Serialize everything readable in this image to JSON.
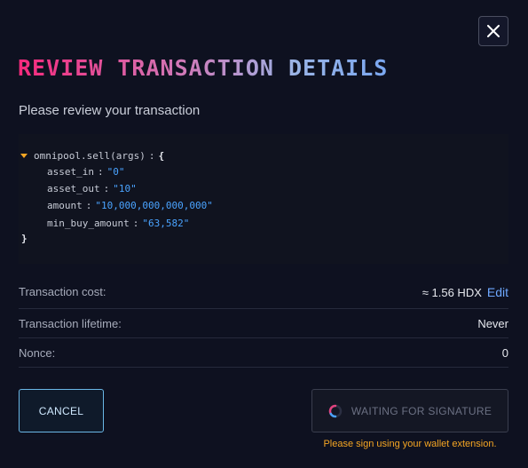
{
  "modal": {
    "title": "Review Transaction Details",
    "subtitle": "Please review your transaction",
    "close_icon": "close-icon"
  },
  "call": {
    "function": "omnipool.sell(args)",
    "separator": ":",
    "open_brace": "{",
    "close_brace": "}",
    "args": [
      {
        "key": "asset_in",
        "value": "\"0\""
      },
      {
        "key": "asset_out",
        "value": "\"10\""
      },
      {
        "key": "amount",
        "value": "\"10,000,000,000,000\""
      },
      {
        "key": "min_buy_amount",
        "value": "\"63,582\""
      }
    ]
  },
  "details": {
    "cost_label": "Transaction cost:",
    "cost_value": "≈ 1.56 HDX",
    "edit_label": "Edit",
    "lifetime_label": "Transaction lifetime:",
    "lifetime_value": "Never",
    "nonce_label": "Nonce:",
    "nonce_value": "0"
  },
  "actions": {
    "cancel_label": "Cancel",
    "waiting_label": "Waiting for signature",
    "hint": "Please sign using your wallet extension."
  },
  "colors": {
    "background": "#0e1120",
    "accent_pink": "#f6297c",
    "accent_blue": "#7aa7f0",
    "hint_orange": "#f5a623",
    "code_value": "#4aa3ff"
  }
}
